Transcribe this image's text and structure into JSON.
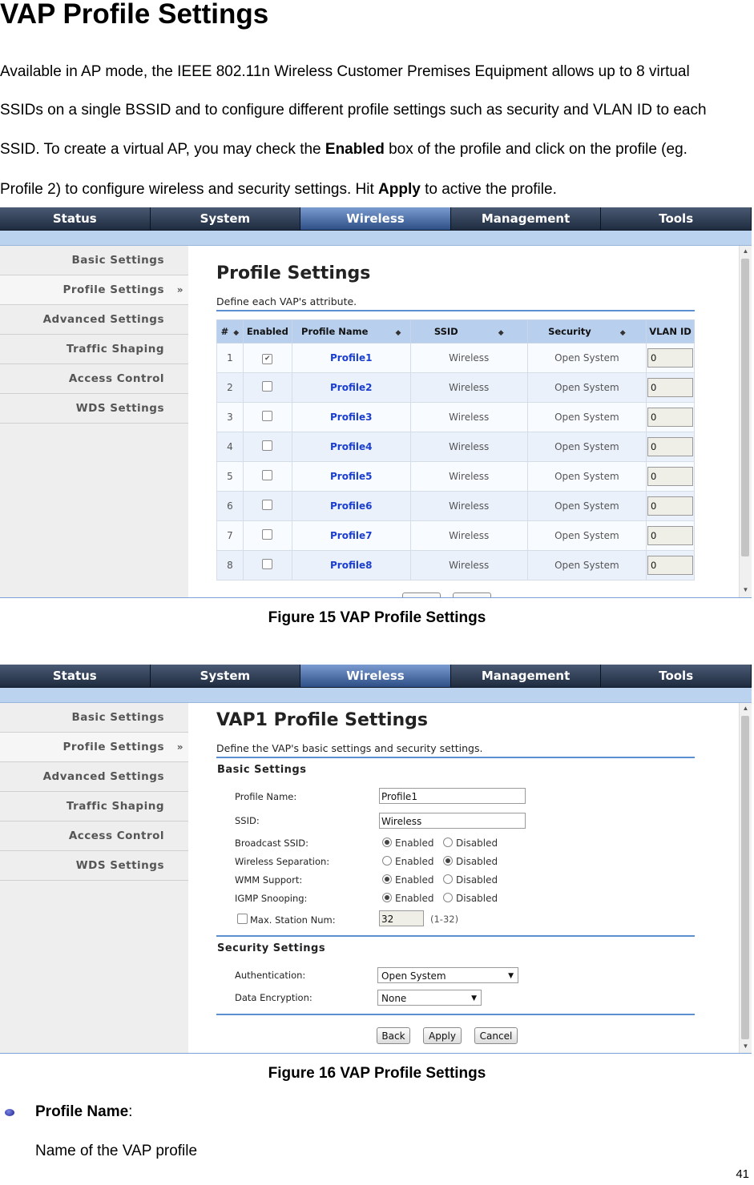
{
  "doc": {
    "title": "VAP Profile Settings",
    "para1": "Available in AP mode, the IEEE 802.11n Wireless Customer Premises Equipment allows up to 8 virtual",
    "para2": "SSIDs on a single BSSID and to configure different profile settings such as security and VLAN ID to each",
    "para3_a": "SSID.    To create a virtual AP, you may check the ",
    "para3_b": "Enabled",
    "para3_c": " box of the profile and click on the profile (eg.",
    "para4_a": "Profile 2) to configure wireless and security settings.    Hit ",
    "para4_b": "Apply",
    "para4_c": " to active the profile.",
    "caption1": "Figure 15 VAP Profile Settings",
    "caption2": "Figure 16 VAP Profile Settings",
    "bullet_label": "Profile Name",
    "bullet_colon": ":",
    "bullet_desc": "Name of the VAP profile",
    "page_number": "41"
  },
  "nav": {
    "tabs": [
      "Status",
      "System",
      "Wireless",
      "Management",
      "Tools"
    ],
    "active": "Wireless"
  },
  "sidebar": {
    "items": [
      "Basic Settings",
      "Profile Settings",
      "Advanced Settings",
      "Traffic Shaping",
      "Access Control",
      "WDS Settings"
    ],
    "active_arrow": "»"
  },
  "fig1": {
    "title": "Profile Settings",
    "subtitle": "Define each VAP's attribute.",
    "headers": [
      "#",
      "Enabled",
      "Profile Name",
      "SSID",
      "Security",
      "VLAN ID"
    ],
    "sort_glyph": "◆",
    "rows": [
      {
        "num": "1",
        "enabled": "✔",
        "profile": "Profile1",
        "ssid": "Wireless",
        "security": "Open System",
        "vlan": "0"
      },
      {
        "num": "2",
        "enabled": "",
        "profile": "Profile2",
        "ssid": "Wireless",
        "security": "Open System",
        "vlan": "0"
      },
      {
        "num": "3",
        "enabled": "",
        "profile": "Profile3",
        "ssid": "Wireless",
        "security": "Open System",
        "vlan": "0"
      },
      {
        "num": "4",
        "enabled": "",
        "profile": "Profile4",
        "ssid": "Wireless",
        "security": "Open System",
        "vlan": "0"
      },
      {
        "num": "5",
        "enabled": "",
        "profile": "Profile5",
        "ssid": "Wireless",
        "security": "Open System",
        "vlan": "0"
      },
      {
        "num": "6",
        "enabled": "",
        "profile": "Profile6",
        "ssid": "Wireless",
        "security": "Open System",
        "vlan": "0"
      },
      {
        "num": "7",
        "enabled": "",
        "profile": "Profile7",
        "ssid": "Wireless",
        "security": "Open System",
        "vlan": "0"
      },
      {
        "num": "8",
        "enabled": "",
        "profile": "Profile8",
        "ssid": "Wireless",
        "security": "Open System",
        "vlan": "0"
      }
    ]
  },
  "fig2": {
    "title": "VAP1 Profile Settings",
    "subtitle": "Define the VAP's basic settings and security settings.",
    "basic_heading": "Basic Settings",
    "profile_name_label": "Profile Name:",
    "profile_name_value": "Profile1",
    "ssid_label": "SSID:",
    "ssid_value": "Wireless",
    "broadcast_label": "Broadcast SSID:",
    "separation_label": "Wireless Separation:",
    "wmm_label": "WMM Support:",
    "igmp_label": "IGMP Snooping:",
    "enabled_text": "Enabled",
    "disabled_text": "Disabled",
    "max_station_label": "Max. Station Num:",
    "max_station_value": "32",
    "max_station_range": "(1-32)",
    "security_heading": "Security Settings",
    "auth_label": "Authentication:",
    "auth_value": "Open System",
    "enc_label": "Data Encryption:",
    "enc_value": "None",
    "dropdown_glyph": "▼",
    "buttons": {
      "back": "Back",
      "apply": "Apply",
      "cancel": "Cancel"
    }
  }
}
